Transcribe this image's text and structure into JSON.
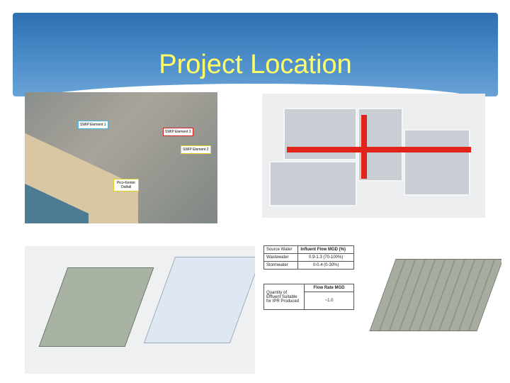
{
  "slide": {
    "title": "Project Location"
  },
  "map": {
    "labels": [
      "SWIP Element 1",
      "SWIP Element 3",
      "SWIP Element 2",
      "Pico-Kenter Outfall"
    ]
  },
  "table1": {
    "headers": [
      "Source Water",
      "Influent Flow MGD (%)"
    ],
    "rows": [
      [
        "Wastewater",
        "0.9-1.3 (70-100%)"
      ],
      [
        "Stormwater",
        "0-0.4 (0-30%)"
      ]
    ]
  },
  "table2": {
    "headers": [
      "Quantity of Effluent Suitable for IPR Produced",
      "Flow Rate MGD"
    ],
    "value": "~1.0"
  }
}
